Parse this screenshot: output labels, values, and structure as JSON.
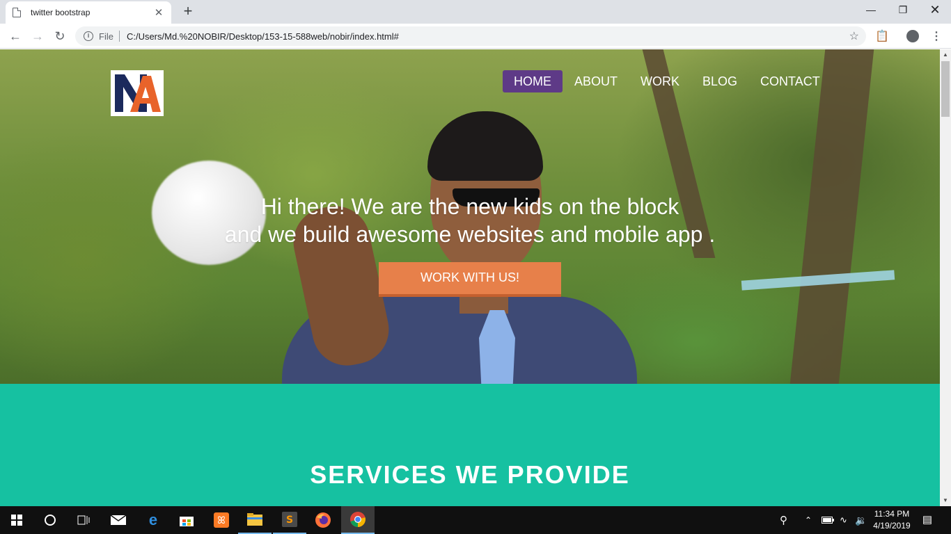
{
  "browser": {
    "tab_title": "twitter bootstrap",
    "tab_close": "✕",
    "new_tab": "+",
    "scheme_label": "File",
    "url": "C:/Users/Md.%20NOBIR/Desktop/153-15-588web/nobir/index.html#",
    "window_controls": {
      "minimize": "—",
      "maximize": "❐",
      "close": "✕"
    }
  },
  "site": {
    "logo_text": "NA",
    "nav": [
      {
        "label": "HOME",
        "active": true
      },
      {
        "label": "ABOUT",
        "active": false
      },
      {
        "label": "WORK",
        "active": false
      },
      {
        "label": "BLOG",
        "active": false
      },
      {
        "label": "CONTACT",
        "active": false
      }
    ],
    "hero": {
      "line1": "Hi there! We are the new kids on the block",
      "line2": "and we build awesome websites and mobile app .",
      "cta": "WORK WITH US!"
    },
    "services_title": "SERVICES WE PROVIDE",
    "colors": {
      "nav_active": "#5e3a87",
      "cta": "#e7804a",
      "services_bg": "#16c1a1",
      "logo_navy": "#1b2a5c",
      "logo_orange": "#e8632a"
    }
  },
  "taskbar": {
    "time": "11:34 PM",
    "date": "4/19/2019",
    "icons": [
      "windows-start-icon",
      "cortana-search-icon",
      "task-view-icon",
      "mail-icon",
      "edge-icon",
      "store-icon",
      "xampp-icon",
      "file-explorer-icon",
      "sublime-text-icon",
      "firefox-icon",
      "chrome-icon"
    ]
  }
}
